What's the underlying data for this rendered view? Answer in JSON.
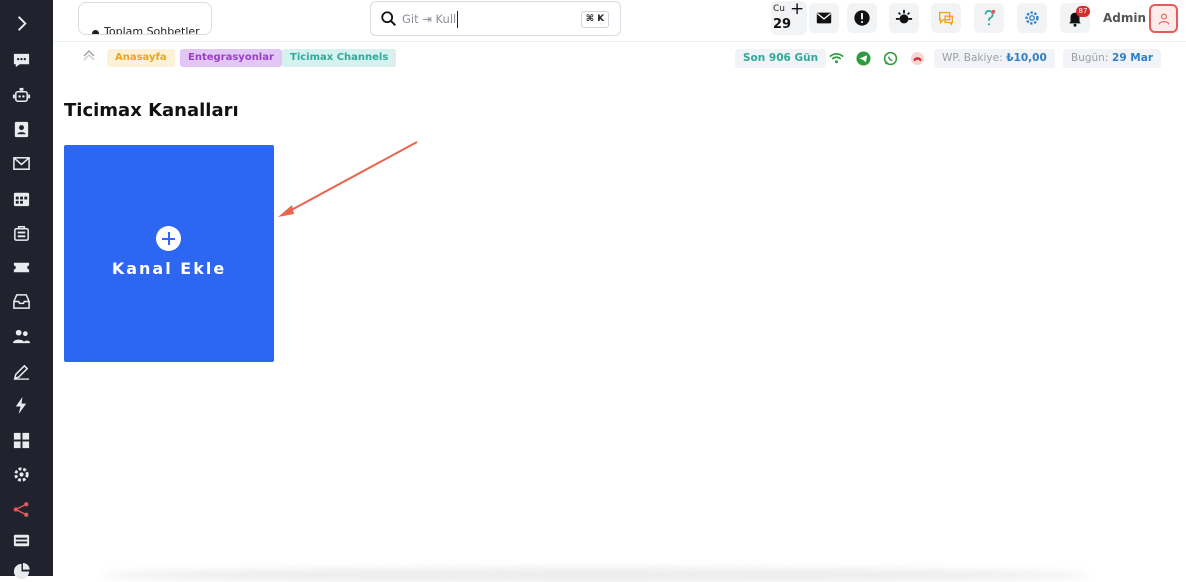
{
  "sidebar": {
    "items": [
      {
        "icon": "chevron-right-icon",
        "active": false
      },
      {
        "icon": "chat-icon",
        "active": false
      },
      {
        "icon": "robot-icon",
        "active": false
      },
      {
        "icon": "contacts-icon",
        "active": false
      },
      {
        "icon": "mail-icon",
        "active": false
      },
      {
        "icon": "calendar-icon",
        "active": false
      },
      {
        "icon": "bag-icon",
        "active": false
      },
      {
        "icon": "ticket-icon",
        "active": false
      },
      {
        "icon": "inbox-icon",
        "active": false
      },
      {
        "icon": "users-icon",
        "active": false
      },
      {
        "icon": "edit-icon",
        "active": false
      },
      {
        "icon": "lightning-icon",
        "active": false
      },
      {
        "icon": "grid-icon",
        "active": false
      },
      {
        "icon": "settings-icon",
        "active": false
      },
      {
        "icon": "share-icon",
        "active": true
      },
      {
        "icon": "keyboard-icon",
        "active": false
      },
      {
        "icon": "pie-chart-icon",
        "active": false
      }
    ],
    "active_color": "#e8595b"
  },
  "header": {
    "chats_label": "Toplam Sohbetler",
    "search_placeholder": "Git ⇥ Kull",
    "search_shortcut": "⌘ K",
    "calendar_day": "Cu",
    "calendar_date": "29",
    "notification_count": "87",
    "user_name": "Admin"
  },
  "breadcrumb": {
    "items": [
      "Anasayfa",
      "Entegrasyonlar",
      "Ticimax Channels"
    ]
  },
  "status": {
    "days": "Son 906 Gün",
    "wp_balance_label": "WP. Bakiye:",
    "wp_balance_value": "₺10,00",
    "today_label": "Bugün:",
    "today_value": "29 Mar"
  },
  "main": {
    "title": "Ticimax Kanalları",
    "add_channel_label": "Kanal Ekle"
  },
  "colors": {
    "sidebar_bg": "#20232d",
    "card_bg": "#2d66f1",
    "annotation_arrow": "#e8654f"
  }
}
